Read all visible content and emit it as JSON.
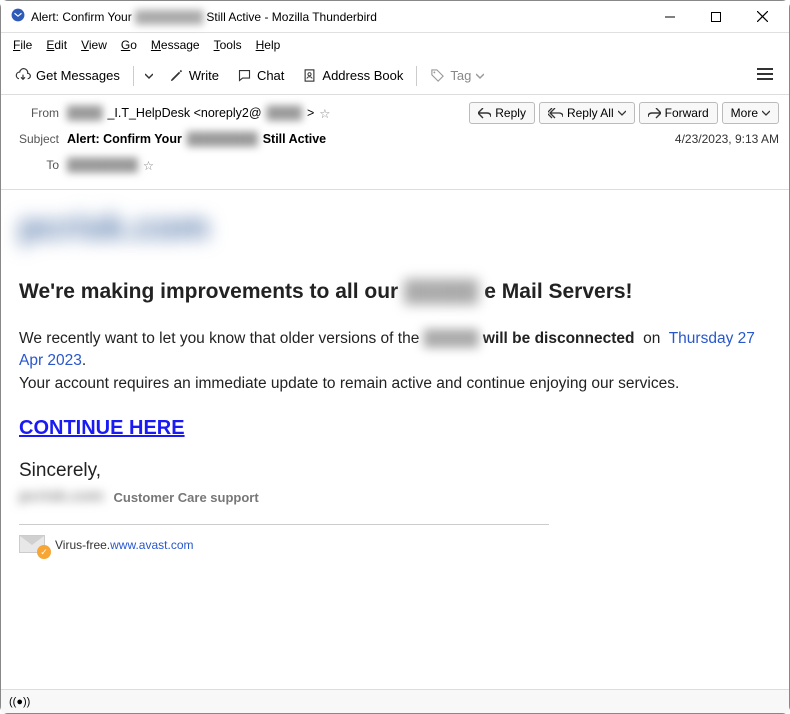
{
  "window": {
    "title_prefix": "Alert: Confirm Your",
    "title_blur": "████████",
    "title_suffix": "Still Active - Mozilla Thunderbird"
  },
  "menubar": [
    "File",
    "Edit",
    "View",
    "Go",
    "Message",
    "Tools",
    "Help"
  ],
  "toolbar": {
    "get_messages": "Get Messages",
    "write": "Write",
    "chat": "Chat",
    "address_book": "Address Book",
    "tag": "Tag"
  },
  "headers": {
    "from_label": "From",
    "from_blur1": "████",
    "from_text": "_I.T_HelpDesk <noreply2@",
    "from_blur2": "████",
    "from_end": ">",
    "subject_label": "Subject",
    "subject_prefix": "Alert: Confirm Your",
    "subject_blur": "████████",
    "subject_suffix": "Still Active",
    "to_label": "To",
    "to_blur": "████████",
    "datetime": "4/23/2023, 9:13 AM"
  },
  "actions": {
    "reply": "Reply",
    "reply_all": "Reply All",
    "forward": "Forward",
    "more": "More"
  },
  "mail": {
    "logo": "pcrisk.com",
    "heading_prefix": "We're making improvements to all our",
    "heading_blur": "█████",
    "heading_suffix": "e Mail Servers!",
    "p1_a": "We recently want to let you know that older versions of the",
    "p1_blur": "█████",
    "p1_b": "will be disconnected",
    "p1_c": "on",
    "p1_date": "Thursday 27 Apr 2023",
    "p1_dot": ".",
    "p2": "Your account requires an immediate update to remain active and continue enjoying our services.",
    "continue": "CONTINUE HERE",
    "sincerely": "Sincerely,",
    "sig_blur": "pcrisk.com",
    "sig_text": "Customer Care support",
    "vf_text": "Virus-free.",
    "vf_link": "www.avast.com"
  }
}
